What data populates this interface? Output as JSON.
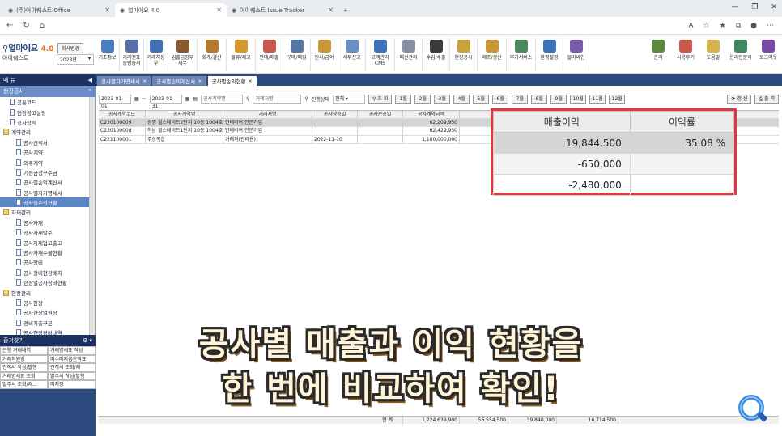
{
  "browser": {
    "tabs": [
      {
        "label": "(주)아이퀘스트 Office",
        "active": false
      },
      {
        "label": "얼마에요 4.0",
        "active": true
      },
      {
        "label": "아이퀘스트 Issue Tracker",
        "active": false
      }
    ],
    "new_tab": "+"
  },
  "app": {
    "logo": "얼마에요",
    "version": "4.0",
    "company": "아이퀘스트",
    "change_company": "회사변경",
    "year": "2023년"
  },
  "menu": [
    {
      "label": "기초정보",
      "color": "#4a7cc2"
    },
    {
      "label": "거래전표\n증빙증서",
      "color": "#5a6fa8"
    },
    {
      "label": "거래처장부",
      "color": "#3f6fb5"
    },
    {
      "label": "입출금장부\n재무",
      "color": "#8a5a2e"
    },
    {
      "label": "회계/결산",
      "color": "#b57a2e"
    },
    {
      "label": "물류/재고",
      "color": "#d69a2a"
    },
    {
      "label": "판매/매출",
      "color": "#c9584a"
    },
    {
      "label": "구매/매입",
      "color": "#5577a8"
    },
    {
      "label": "인사/급여",
      "color": "#c9963a"
    },
    {
      "label": "세무신고",
      "color": "#6a8fc2"
    },
    {
      "label": "고객관리\nCMS",
      "color": "#3e72b8"
    },
    {
      "label": "매선관리",
      "color": "#8a8fa8"
    },
    {
      "label": "수입/수출",
      "color": "#3a3a3a"
    },
    {
      "label": "현장공사",
      "color": "#c9a23a"
    },
    {
      "label": "제조/생산",
      "color": "#c9963a"
    },
    {
      "label": "부가서비스",
      "color": "#4a8a5e"
    },
    {
      "label": "환경설정",
      "color": "#3e72b8"
    },
    {
      "label": "얼마싸인",
      "color": "#7a5aa8"
    }
  ],
  "right_menu": [
    {
      "label": "관리",
      "color": "#5a8a3e"
    },
    {
      "label": "사용후기",
      "color": "#c9584a"
    },
    {
      "label": "도움말",
      "color": "#d6b24a"
    },
    {
      "label": "온라인문의",
      "color": "#3e8a5e"
    },
    {
      "label": "로그아웃",
      "color": "#7a4aa8"
    }
  ],
  "sidebar": {
    "menu_title": "메 뉴",
    "section": "현장공사",
    "items": [
      {
        "label": "공통코드",
        "type": "doc",
        "level": 1
      },
      {
        "label": "현장장고설정",
        "type": "doc",
        "level": 1
      },
      {
        "label": "공사양식",
        "type": "doc",
        "level": 1
      },
      {
        "label": "계약관리",
        "type": "folder",
        "level": 0
      },
      {
        "label": "공사견적서",
        "type": "doc",
        "level": 2
      },
      {
        "label": "공사계약",
        "type": "doc",
        "level": 2
      },
      {
        "label": "외주계약",
        "type": "doc",
        "level": 2
      },
      {
        "label": "기성금청구수금",
        "type": "doc",
        "level": 2
      },
      {
        "label": "공사별손익계산서",
        "type": "doc",
        "level": 2
      },
      {
        "label": "공사별자가명세서",
        "type": "doc",
        "level": 2
      },
      {
        "label": "공사별손익현황",
        "type": "doc",
        "level": 2,
        "selected": true
      },
      {
        "label": "자재관리",
        "type": "folder",
        "level": 0
      },
      {
        "label": "공사자재",
        "type": "doc",
        "level": 2
      },
      {
        "label": "공사자재발주",
        "type": "doc",
        "level": 2
      },
      {
        "label": "공사자재입고출고",
        "type": "doc",
        "level": 2
      },
      {
        "label": "공사자재수불현황",
        "type": "doc",
        "level": 2
      },
      {
        "label": "공사장비",
        "type": "doc",
        "level": 2
      },
      {
        "label": "공사장비현장배치",
        "type": "doc",
        "level": 2
      },
      {
        "label": "현장별공사장비현황",
        "type": "doc",
        "level": 2
      },
      {
        "label": "현장관리",
        "type": "folder",
        "level": 0
      },
      {
        "label": "공사현장",
        "type": "doc",
        "level": 2
      },
      {
        "label": "공사현장별원장",
        "type": "doc",
        "level": 2
      },
      {
        "label": "경비지출구분",
        "type": "doc",
        "level": 2
      },
      {
        "label": "공사현장경비내역",
        "type": "doc",
        "level": 2
      },
      {
        "label": "현장경비실행내역서",
        "type": "doc",
        "level": 2
      },
      {
        "label": "일작업일지",
        "type": "doc",
        "level": 2
      }
    ],
    "favorites_title": "즐겨찾기",
    "favorites": [
      "은행 거래내역",
      "거래명세표 작성",
      "거래처원장",
      "미수미지급잔액표",
      "견적서 작성/발행",
      "견적서 조회/재",
      "거래명세표 조회",
      "발주서 작성/발행",
      "발주서 조회/재...",
      "미지정"
    ]
  },
  "content_tabs": [
    {
      "label": "공사별자가명세서",
      "active": false
    },
    {
      "label": "공사별손익계산서",
      "active": false
    },
    {
      "label": "공사별손익현황",
      "active": true
    }
  ],
  "filter": {
    "date_from": "2023-01-01",
    "date_to": "2023-01-31",
    "contract_placeholder": "공사계약명",
    "client_placeholder": "거래처명",
    "status_label": "진행상태",
    "status_value": "전체",
    "search": "조 회",
    "months": [
      "1월",
      "2월",
      "3월",
      "4월",
      "5월",
      "6월",
      "7월",
      "8월",
      "9월",
      "10월",
      "11월",
      "12월"
    ],
    "refresh": "갱 신",
    "print": "출 력"
  },
  "grid": {
    "columns": [
      "공사계약코드",
      "공사계약명",
      "거래처명",
      "공사착공일",
      "공사준공일",
      "공사계약금액",
      "",
      "",
      "",
      "",
      "진행상태"
    ],
    "rows": [
      [
        "C230100009",
        "광명 힐스테이트2단지 10동 1004호",
        "인테리어 전문가업",
        "",
        "",
        "62,209,950",
        "",
        "",
        "",
        "",
        "진행"
      ],
      [
        "C230100008",
        "하남 힐스테이트1단지 10동 1004호",
        "인테리어 전문가업",
        "",
        "",
        "62,429,950",
        "",
        "",
        "",
        "",
        "진행"
      ],
      [
        "C221100001",
        "주상복합",
        "거래처(관리용)",
        "2022-11-10",
        "",
        "1,100,000,000",
        "",
        "",
        "",
        "",
        "진행"
      ]
    ],
    "footer": {
      "label": "합 계",
      "values": [
        "1,224,639,900",
        "56,554,500",
        "39,840,000",
        "16,714,500"
      ]
    }
  },
  "zoom": {
    "headers": [
      "매출이익",
      "이익률"
    ],
    "rows": [
      [
        "19,844,500",
        "35.08 %"
      ],
      [
        "-650,000",
        ""
      ],
      [
        "-2,480,000",
        ""
      ]
    ],
    "border_color": "#e0363e"
  },
  "caption": {
    "line1": "공사별 매출과 이익 현황을",
    "line2": "한 번에 비교하여 확인!"
  }
}
